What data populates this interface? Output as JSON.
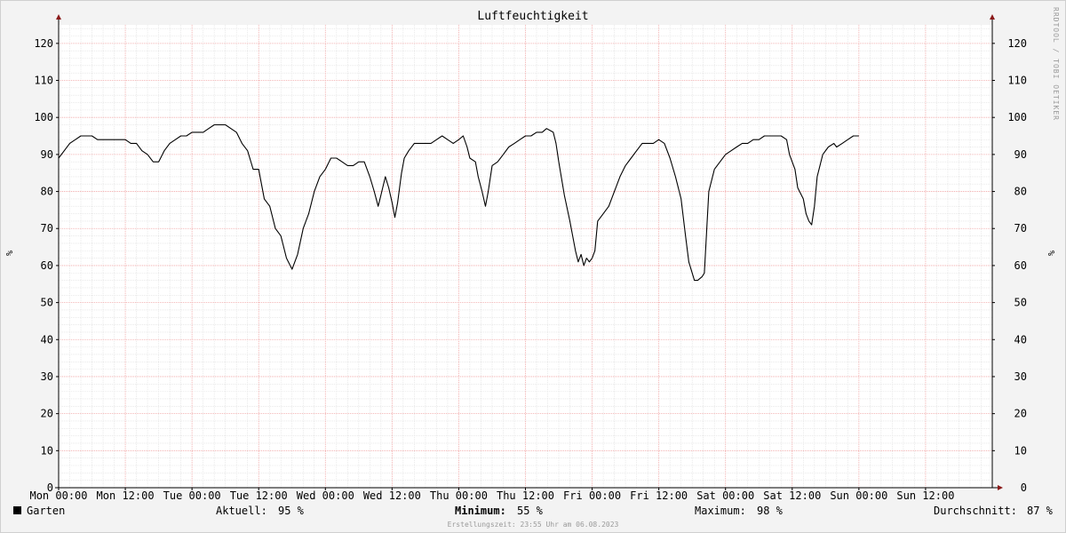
{
  "chart_data": {
    "type": "line",
    "title": "Luftfeuchtigkeit",
    "ylabel": "%",
    "ylim": [
      0,
      125
    ],
    "yticks": [
      0,
      10,
      20,
      30,
      40,
      50,
      60,
      70,
      80,
      90,
      100,
      110,
      120
    ],
    "xlim": [
      0,
      168
    ],
    "xticks": [
      {
        "hour": 0,
        "label": "Mon 00:00"
      },
      {
        "hour": 12,
        "label": "Mon 12:00"
      },
      {
        "hour": 24,
        "label": "Tue 00:00"
      },
      {
        "hour": 36,
        "label": "Tue 12:00"
      },
      {
        "hour": 48,
        "label": "Wed 00:00"
      },
      {
        "hour": 60,
        "label": "Wed 12:00"
      },
      {
        "hour": 72,
        "label": "Thu 00:00"
      },
      {
        "hour": 84,
        "label": "Thu 12:00"
      },
      {
        "hour": 96,
        "label": "Fri 00:00"
      },
      {
        "hour": 108,
        "label": "Fri 12:00"
      },
      {
        "hour": 120,
        "label": "Sat 00:00"
      },
      {
        "hour": 132,
        "label": "Sat 12:00"
      },
      {
        "hour": 144,
        "label": "Sun 00:00"
      },
      {
        "hour": 156,
        "label": "Sun 12:00"
      }
    ],
    "grid": true,
    "series": [
      {
        "name": "Garten",
        "color": "#000000",
        "points": [
          [
            0,
            89
          ],
          [
            1,
            91
          ],
          [
            2,
            93
          ],
          [
            3,
            94
          ],
          [
            4,
            95
          ],
          [
            5,
            95
          ],
          [
            6,
            95
          ],
          [
            7,
            94
          ],
          [
            8,
            94
          ],
          [
            10,
            94
          ],
          [
            11,
            94
          ],
          [
            12,
            94
          ],
          [
            13,
            93
          ],
          [
            14,
            93
          ],
          [
            15,
            91
          ],
          [
            16,
            90
          ],
          [
            17,
            88
          ],
          [
            18,
            88
          ],
          [
            19,
            91
          ],
          [
            20,
            93
          ],
          [
            21,
            94
          ],
          [
            22,
            95
          ],
          [
            23,
            95
          ],
          [
            24,
            96
          ],
          [
            26,
            96
          ],
          [
            27,
            97
          ],
          [
            28,
            98
          ],
          [
            30,
            98
          ],
          [
            31,
            97
          ],
          [
            32,
            96
          ],
          [
            33,
            93
          ],
          [
            34,
            91
          ],
          [
            35,
            86
          ],
          [
            36,
            86
          ],
          [
            37,
            78
          ],
          [
            38,
            76
          ],
          [
            39,
            70
          ],
          [
            40,
            68
          ],
          [
            41,
            62
          ],
          [
            42,
            59
          ],
          [
            43,
            63
          ],
          [
            44,
            70
          ],
          [
            45,
            74
          ],
          [
            46,
            80
          ],
          [
            47,
            84
          ],
          [
            48,
            86
          ],
          [
            49,
            89
          ],
          [
            50,
            89
          ],
          [
            51,
            88
          ],
          [
            52,
            87
          ],
          [
            53,
            87
          ],
          [
            54,
            88
          ],
          [
            55,
            88
          ],
          [
            56,
            84
          ],
          [
            56.8,
            80
          ],
          [
            57.5,
            76
          ],
          [
            58,
            79
          ],
          [
            58.8,
            84
          ],
          [
            59.4,
            81
          ],
          [
            60,
            77
          ],
          [
            60.5,
            73
          ],
          [
            61,
            77
          ],
          [
            61.7,
            85
          ],
          [
            62.2,
            89
          ],
          [
            63,
            91
          ],
          [
            64,
            93
          ],
          [
            66,
            93
          ],
          [
            67,
            93
          ],
          [
            68,
            94
          ],
          [
            69,
            95
          ],
          [
            70,
            94
          ],
          [
            71,
            93
          ],
          [
            72,
            94
          ],
          [
            72.8,
            95
          ],
          [
            73.5,
            92
          ],
          [
            74,
            89
          ],
          [
            75,
            88
          ],
          [
            75.5,
            84
          ],
          [
            76.2,
            80
          ],
          [
            76.8,
            76
          ],
          [
            77.3,
            80
          ],
          [
            78,
            87
          ],
          [
            79,
            88
          ],
          [
            80,
            90
          ],
          [
            81,
            92
          ],
          [
            82,
            93
          ],
          [
            83,
            94
          ],
          [
            84,
            95
          ],
          [
            85,
            95
          ],
          [
            86,
            96
          ],
          [
            87,
            96
          ],
          [
            87.8,
            97
          ],
          [
            89,
            96
          ],
          [
            89.5,
            93
          ],
          [
            90,
            88
          ],
          [
            91,
            79
          ],
          [
            92,
            72
          ],
          [
            93,
            64
          ],
          [
            93.5,
            61
          ],
          [
            94,
            63
          ],
          [
            94.5,
            60
          ],
          [
            95,
            62
          ],
          [
            95.5,
            61
          ],
          [
            96,
            62
          ],
          [
            96.5,
            64
          ],
          [
            97,
            72
          ],
          [
            98,
            74
          ],
          [
            99,
            76
          ],
          [
            100,
            80
          ],
          [
            101,
            84
          ],
          [
            102,
            87
          ],
          [
            103,
            89
          ],
          [
            104,
            91
          ],
          [
            105,
            93
          ],
          [
            107,
            93
          ],
          [
            108,
            94
          ],
          [
            109,
            93
          ],
          [
            110,
            89
          ],
          [
            111,
            84
          ],
          [
            112,
            78
          ],
          [
            112.8,
            68
          ],
          [
            113.4,
            61
          ],
          [
            114,
            58
          ],
          [
            114.4,
            56
          ],
          [
            115,
            56
          ],
          [
            115.8,
            57
          ],
          [
            116.2,
            58
          ],
          [
            117,
            80
          ],
          [
            118,
            86
          ],
          [
            119,
            88
          ],
          [
            120,
            90
          ],
          [
            121,
            91
          ],
          [
            122,
            92
          ],
          [
            123,
            93
          ],
          [
            124,
            93
          ],
          [
            125,
            94
          ],
          [
            126,
            94
          ],
          [
            127,
            95
          ],
          [
            129,
            95
          ],
          [
            130,
            95
          ],
          [
            131,
            94
          ],
          [
            131.5,
            90
          ],
          [
            132.5,
            86
          ],
          [
            133,
            81
          ],
          [
            134,
            78
          ],
          [
            134.5,
            74
          ],
          [
            135,
            72
          ],
          [
            135.5,
            71
          ],
          [
            136,
            76
          ],
          [
            136.5,
            84
          ],
          [
            137.5,
            90
          ],
          [
            138.5,
            92
          ],
          [
            139.5,
            93
          ],
          [
            140,
            92
          ],
          [
            141,
            93
          ],
          [
            142,
            94
          ],
          [
            143,
            95
          ],
          [
            144,
            95
          ]
        ]
      }
    ],
    "legend": {
      "series_label": "Garten",
      "aktuell_label": "Aktuell:",
      "aktuell_value": "95 %",
      "minimum_label": "Minimum:",
      "minimum_value": "55 %",
      "maximum_label": "Maximum:",
      "maximum_value": "98 %",
      "durchschnitt_label": "Durchschnitt:",
      "durchschnitt_value": "87 %"
    }
  },
  "watermark": "RRDTOOL / TOBI OETIKER",
  "footer": "Erstellungszeit: 23:55 Uhr am 06.08.2023",
  "colors": {
    "background": "#f3f3f3",
    "plot_background": "#ffffff",
    "minor_grid": "#dddddd",
    "major_grid": "#f0a0a0",
    "arrow": "#8b1a1a",
    "line": "#000000"
  }
}
